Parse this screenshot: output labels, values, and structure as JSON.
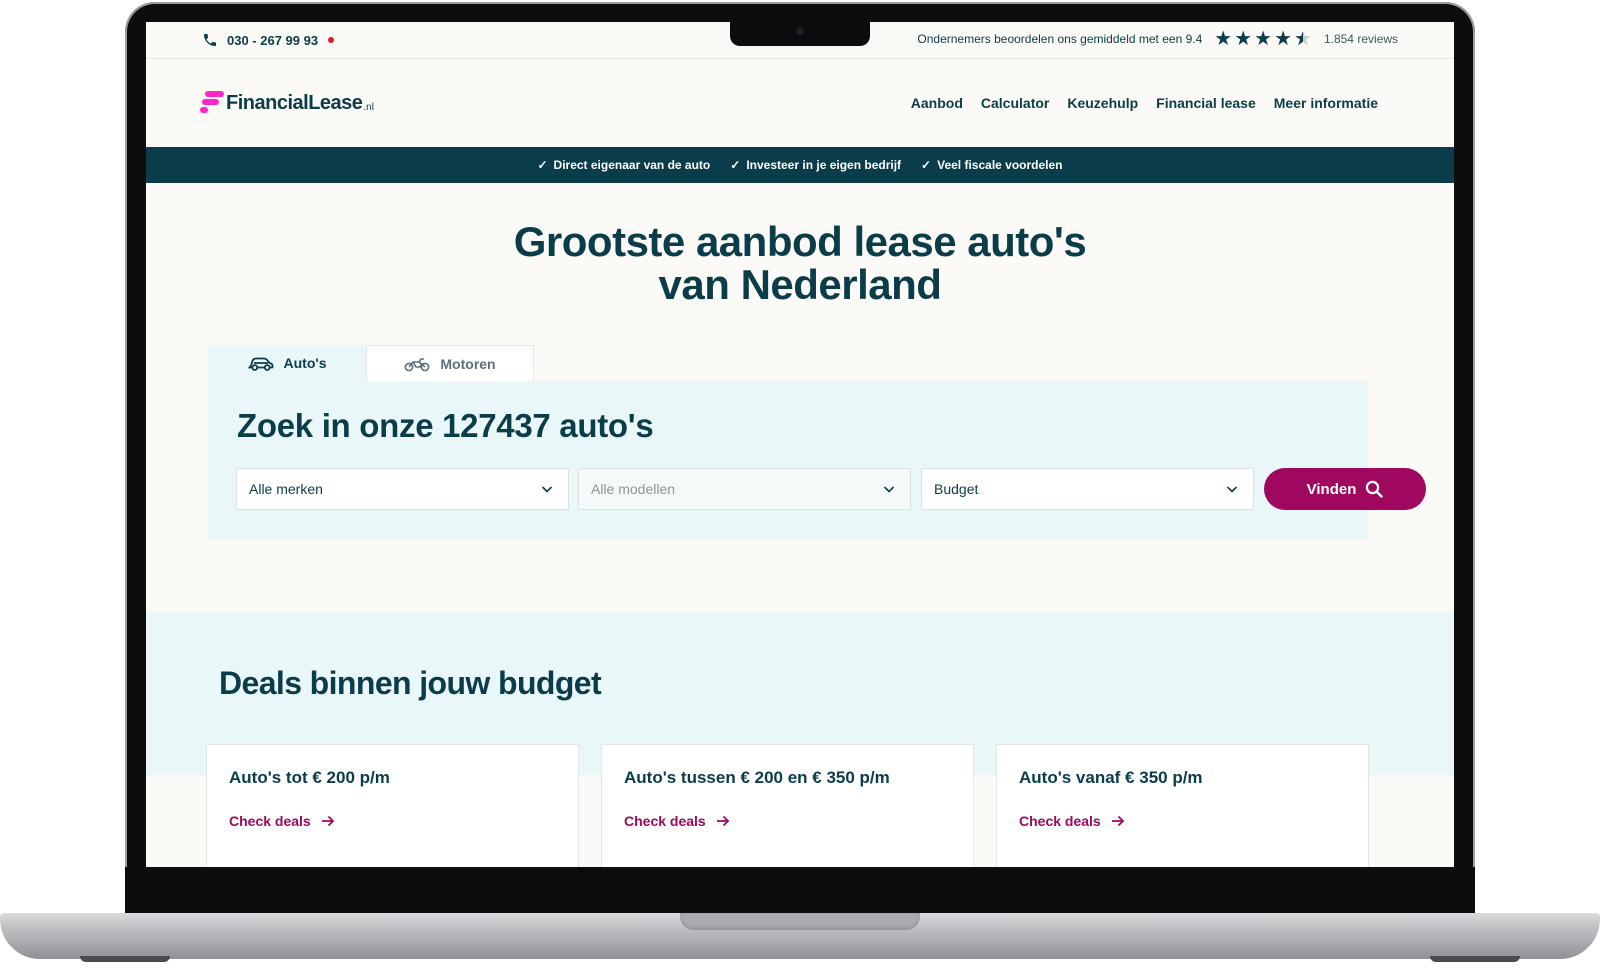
{
  "topbar": {
    "phone": "030 - 267 99 93",
    "rating_text": "Ondernemers beoordelen ons gemiddeld met een 9.4",
    "stars": 4.5,
    "reviews": "1.854 reviews"
  },
  "header": {
    "logo_text": "FinancialLease",
    "logo_tld": ".nl",
    "nav": [
      "Aanbod",
      "Calculator",
      "Keuzehulp",
      "Financial lease",
      "Meer informatie"
    ]
  },
  "usp": [
    "Direct eigenaar van de auto",
    "Investeer in je eigen bedrijf",
    "Veel fiscale voordelen"
  ],
  "hero": {
    "title_line1": "Grootste aanbod lease auto's",
    "title_line2": "van Nederland"
  },
  "search": {
    "tabs": [
      "Auto's",
      "Motoren"
    ],
    "title": "Zoek in onze 127437 auto's",
    "brand_select": "Alle merken",
    "model_select": "Alle modellen",
    "budget_select": "Budget",
    "button": "Vinden"
  },
  "deals": {
    "title": "Deals binnen jouw budget",
    "cards": [
      {
        "title": "Auto's tot € 200 p/m",
        "link": "Check deals"
      },
      {
        "title": "Auto's tussen € 200 en € 350 p/m",
        "link": "Check deals"
      },
      {
        "title": "Auto's vanaf € 350 p/m",
        "link": "Check deals"
      }
    ]
  },
  "colors": {
    "primary": "#0b3c49",
    "accent": "#a0075e",
    "logo": "#ff26c8",
    "panel": "#eaf7f8"
  }
}
